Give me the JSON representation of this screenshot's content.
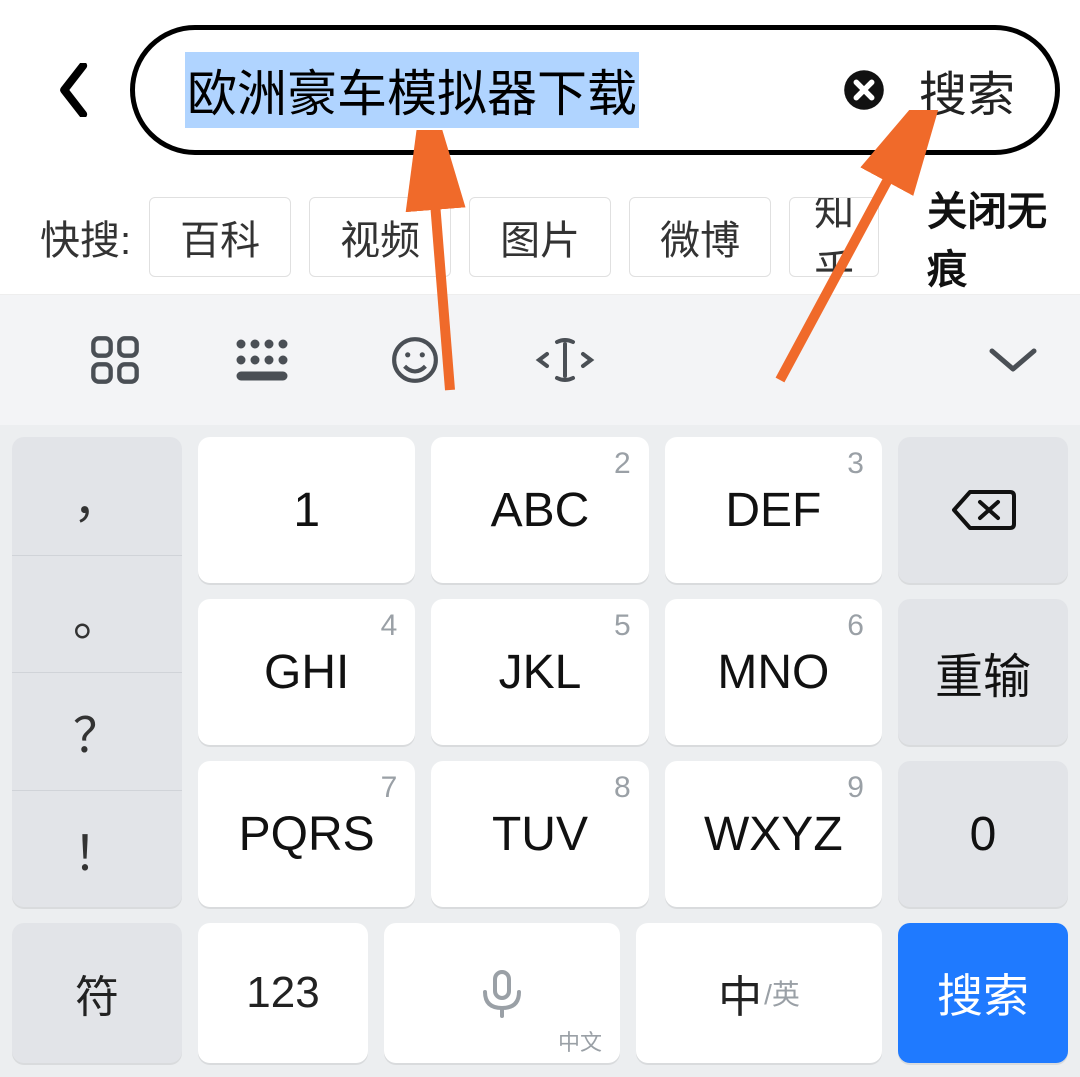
{
  "search": {
    "query": "欧洲豪车模拟器下载",
    "action_label": "搜索"
  },
  "quick": {
    "label": "快搜:",
    "items": [
      "百科",
      "视频",
      "图片",
      "微博",
      "知乎"
    ],
    "close_label": "关闭无痕"
  },
  "strip": {
    "icons": [
      "apps-icon",
      "keyboard-switch-icon",
      "emoji-icon",
      "text-cursor-icon",
      "chevron-down-icon"
    ]
  },
  "keys": {
    "punct": [
      "，",
      "。",
      "？",
      "！"
    ],
    "grid": [
      {
        "digit": "1",
        "label": "1"
      },
      {
        "digit": "2",
        "label": "ABC"
      },
      {
        "digit": "3",
        "label": "DEF"
      },
      {
        "digit": "4",
        "label": "GHI"
      },
      {
        "digit": "5",
        "label": "JKL"
      },
      {
        "digit": "6",
        "label": "MNO"
      },
      {
        "digit": "7",
        "label": "PQRS"
      },
      {
        "digit": "8",
        "label": "TUV"
      },
      {
        "digit": "9",
        "label": "WXYZ"
      }
    ],
    "backspace_label": "",
    "retype_label": "重输",
    "zero_label": "0",
    "symbol_label": "符",
    "numeric_label": "123",
    "space_sub": "中文",
    "lang_primary": "中",
    "lang_secondary": "/英",
    "enter_label": "搜索"
  },
  "annotations": {
    "arrow_color": "#f06a2a"
  }
}
